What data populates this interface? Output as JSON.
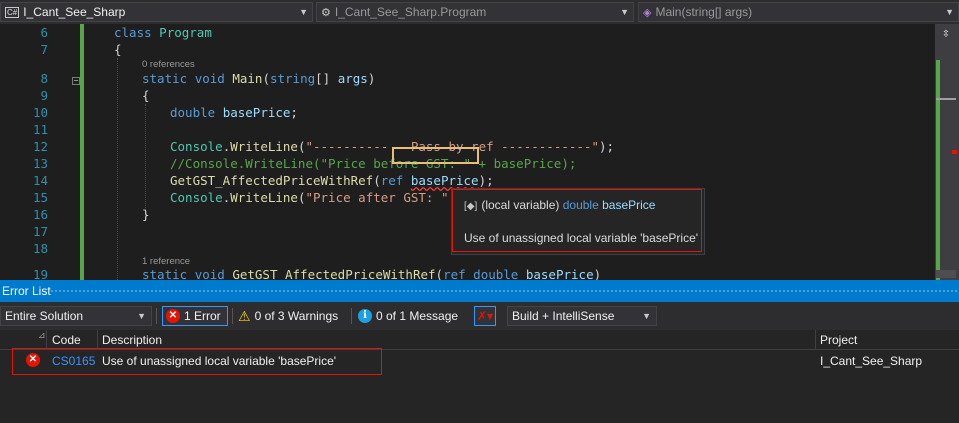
{
  "navbar": {
    "project_badge": "C#",
    "project": "I_Cant_See_Sharp",
    "class_name": "I_Cant_See_Sharp.Program",
    "member": "Main(string[] args)"
  },
  "editor": {
    "line_numbers": [
      "6",
      "7",
      "8",
      "9",
      "10",
      "11",
      "12",
      "13",
      "14",
      "15",
      "16",
      "17",
      "18",
      "19"
    ],
    "lens_main": "0 references",
    "lens_getgst": "1 reference",
    "code": {
      "l6_kw": "class",
      "l6_type": "Program",
      "l7": "{",
      "l8_kw1": "static",
      "l8_kw2": "void",
      "l8_name": "Main",
      "l8_p1": "(",
      "l8_kw3": "string",
      "l8_p2": "[] ",
      "l8_arg": "args",
      "l8_p3": ")",
      "l9": "{",
      "l10_kw": "double",
      "l10_var": "basePrice",
      "l10_end": ";",
      "l12_cls": "Console",
      "l12_dot": ".",
      "l12_m": "WriteLine",
      "l12_p": "(",
      "l12_s": "\"----------   Pass by ref ------------\"",
      "l12_e": ");",
      "l13": "//Console.WriteLine(\"Price before GST: \" + basePrice);",
      "l14_m": "GetGST_AffectedPriceWithRef",
      "l14_p": "(",
      "l14_kw": "ref",
      "l14_sp": " ",
      "l14_var": "basePrice",
      "l14_e": ");",
      "l15_cls": "Console",
      "l15_dot": ".",
      "l15_m": "WriteLine",
      "l15_p": "(",
      "l15_s": "\"Price after GST: \"",
      "l15_rest": " +",
      "l16": "}",
      "l19_kw1": "static",
      "l19_kw2": "void",
      "l19_name": "GetGST_AffectedPriceWithRef",
      "l19_p": "(",
      "l19_kw3": "ref",
      "l19_kw4": "double",
      "l19_var": "basePrice",
      "l19_e": ")"
    }
  },
  "tooltip": {
    "icon": "local-variable-icon",
    "prefix": "(local variable)",
    "type": "double",
    "name": "basePrice",
    "message": "Use of unassigned local variable 'basePrice'"
  },
  "error_list": {
    "title": "Error List",
    "scope": "Entire Solution",
    "errors_label": "1 Error",
    "warnings_label": "0 of 3 Warnings",
    "messages_label": "0 of 1 Message",
    "build_filter": "Build + IntelliSense",
    "columns": {
      "code": "Code",
      "description": "Description",
      "project": "Project"
    },
    "rows": [
      {
        "code": "CS0165",
        "description": "Use of unassigned local variable 'basePrice'",
        "project": "I_Cant_See_Sharp"
      }
    ]
  },
  "colors": {
    "accent": "#007acc",
    "error": "#e51400",
    "keyword": "#569cd6",
    "type": "#4ec9b0",
    "string": "#d69d85",
    "comment": "#57a64a"
  }
}
